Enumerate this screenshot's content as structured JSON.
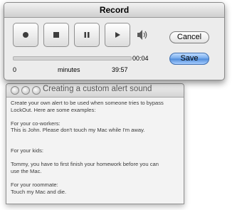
{
  "record_window": {
    "title": "Record",
    "buttons": {
      "record": "record-icon",
      "stop": "stop-icon",
      "pause": "pause-icon",
      "play": "play-icon",
      "volume": "speaker-icon"
    },
    "elapsed": "00:04",
    "progress_fraction": 0.0,
    "scale_start": "0",
    "scale_unit": "minutes",
    "scale_end": "39:57",
    "cancel_label": "Cancel",
    "save_label": "Save"
  },
  "alert_window": {
    "title": "Creating a custom alert sound",
    "intro_line1": "Create your own alert to be used when someone tries to bypass",
    "intro_line2": "LockOut.  Here are some examples:",
    "coworkers_heading": "For your co-workers:",
    "coworkers_text": "This is John.  Please don't touch my Mac while I'm away.",
    "kids_heading": "For your kids:",
    "kids_line1": "Tommy, you have to first finish your homework before you can",
    "kids_line2": "use the Mac.",
    "roommate_heading": "For your roommate:",
    "roommate_text": "Touch my Mac and die."
  }
}
